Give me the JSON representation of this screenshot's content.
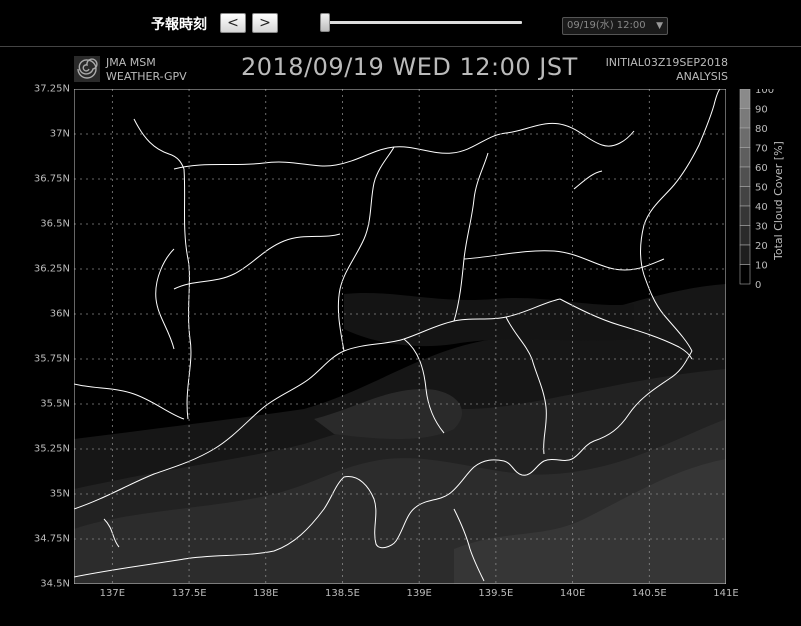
{
  "toolbar": {
    "forecast_time_label": "予報時刻",
    "prev_label": "<",
    "next_label": ">",
    "slider_position": 0,
    "time_select_value": "09/19(水) 12:00",
    "time_select_arrow": "▼"
  },
  "header": {
    "model_line1": "JMA MSM",
    "model_line2": "WEATHER-GPV",
    "datetime_title": "2018/09/19 WED 12:00 JST",
    "initial_line1": "INITIAL03Z19SEP2018",
    "initial_line2": "ANALYSIS"
  },
  "map": {
    "x_ticks": [
      "137E",
      "137.5E",
      "138E",
      "138.5E",
      "139E",
      "139.5E",
      "140E",
      "140.5E",
      "141E"
    ],
    "y_ticks": [
      "37.25N",
      "37N",
      "36.75N",
      "36.5N",
      "36.25N",
      "36N",
      "35.75N",
      "35.5N",
      "35.25N",
      "35N",
      "34.75N",
      "34.5N"
    ],
    "lon_range": [
      136.75,
      141.0
    ],
    "lat_range": [
      34.5,
      37.25
    ],
    "background_color": "#000000",
    "coastline_color": "#ffffff"
  },
  "colorbar": {
    "title": "Total Cloud Cover [%]",
    "labels": [
      "100",
      "90",
      "80",
      "70",
      "60",
      "50",
      "40",
      "30",
      "20",
      "10",
      "0"
    ],
    "colors": [
      "#8a8a8a",
      "#7a7a7a",
      "#6c6c6c",
      "#5e5e5e",
      "#505050",
      "#434343",
      "#363636",
      "#2a2a2a",
      "#1e1e1e",
      "#000000"
    ]
  }
}
